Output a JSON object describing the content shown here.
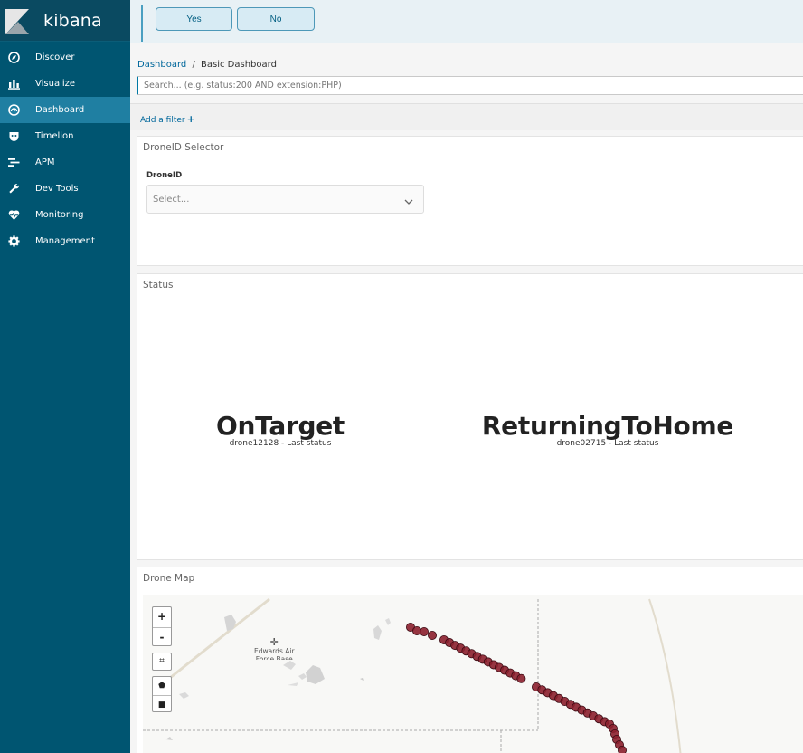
{
  "sidebar": {
    "brand": "kibana",
    "items": [
      {
        "label": "Discover",
        "icon": "compass-icon"
      },
      {
        "label": "Visualize",
        "icon": "bar-chart-icon"
      },
      {
        "label": "Dashboard",
        "icon": "dashboard-icon",
        "active": true
      },
      {
        "label": "Timelion",
        "icon": "shield-icon"
      },
      {
        "label": "APM",
        "icon": "apm-icon"
      },
      {
        "label": "Dev Tools",
        "icon": "wrench-icon"
      },
      {
        "label": "Monitoring",
        "icon": "heartbeat-icon"
      },
      {
        "label": "Management",
        "icon": "gear-icon"
      }
    ]
  },
  "confirm": {
    "yes_label": "Yes",
    "no_label": "No"
  },
  "breadcrumb": {
    "parent": "Dashboard",
    "separator": "/",
    "current": "Basic Dashboard"
  },
  "search": {
    "placeholder": "Search... (e.g. status:200 AND extension:PHP)"
  },
  "filters": {
    "add_label": "Add a filter",
    "add_icon": "+"
  },
  "panels": {
    "selector": {
      "title": "DroneID Selector",
      "field_label": "DroneID",
      "placeholder": "Select..."
    },
    "status": {
      "title": "Status",
      "metrics": [
        {
          "value": "OnTarget",
          "label": "drone12128 - Last status"
        },
        {
          "value": "ReturningToHome",
          "label": "drone02715 - Last status"
        }
      ]
    },
    "map": {
      "title": "Drone Map",
      "place_label": "Edwards Air",
      "place_label_2": "Force Base",
      "zoom_in": "+",
      "zoom_out": "-",
      "fit_icon": "fit-bounds-icon",
      "draw_polygon_icon": "polygon-icon",
      "draw_rect_icon": "rectangle-icon",
      "marker_color": "#8b1f2e"
    }
  },
  "colors": {
    "sidebar": "#005571",
    "active": "#1f7fa2",
    "link": "#00679b"
  }
}
